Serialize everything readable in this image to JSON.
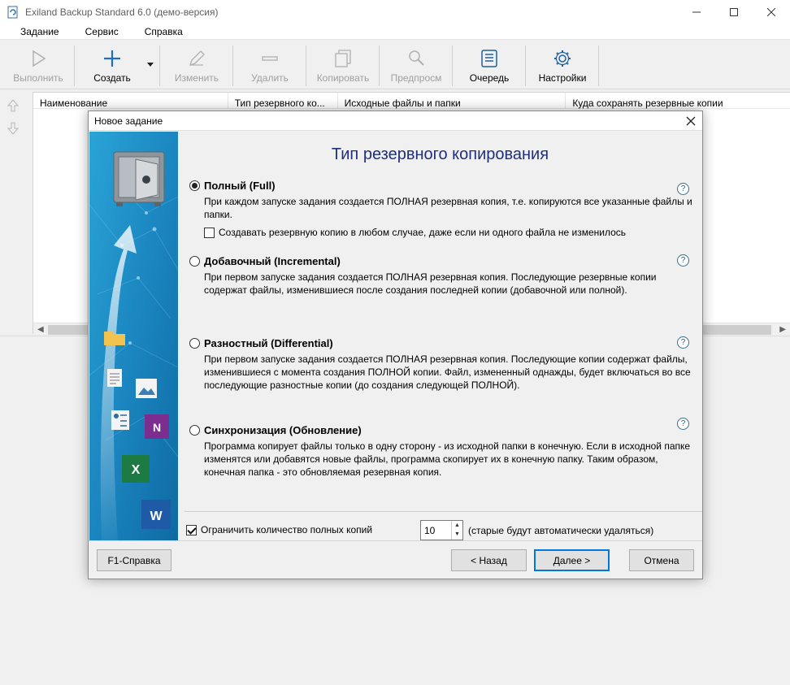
{
  "window": {
    "title": "Exiland Backup Standard 6.0 (демо-версия)",
    "controls": [
      "minimize-icon",
      "maximize-icon",
      "close-icon"
    ]
  },
  "menu": [
    "Задание",
    "Сервис",
    "Справка"
  ],
  "toolbar": {
    "buttons": [
      {
        "label": "Выполнить",
        "icon": "play-icon",
        "enabled": false
      },
      {
        "label": "Создать",
        "icon": "plus-icon",
        "enabled": true
      },
      {
        "label": "Изменить",
        "icon": "pencil-icon",
        "enabled": false
      },
      {
        "label": "Удалить",
        "icon": "minus-icon",
        "enabled": false
      },
      {
        "label": "Копировать",
        "icon": "copy-icon",
        "enabled": false
      },
      {
        "label": "Предпросм",
        "icon": "magnifier-icon",
        "enabled": false
      },
      {
        "label": "Очередь",
        "icon": "queue-list-icon",
        "enabled": true
      },
      {
        "label": "Настройки",
        "icon": "gear-icon",
        "enabled": true
      }
    ]
  },
  "list": {
    "columns": [
      "Наименование",
      "Тип резервного ко...",
      "Исходные файлы и папки",
      "Куда сохранять резервные копии"
    ]
  },
  "dialog": {
    "title": "Новое задание",
    "heading": "Тип резервного копирования",
    "options": [
      {
        "label": "Полный (Full)",
        "checked": true,
        "description": "При каждом запуске задания создается ПОЛНАЯ резервная копия, т.е. копируются все указанные файлы и папки.",
        "sub_checkbox": {
          "label": "Создавать резервную копию в любом случае, даже если ни одного файла не изменилось",
          "checked": false
        }
      },
      {
        "label": "Добавочный (Incremental)",
        "checked": false,
        "description": "При первом запуске задания создается ПОЛНАЯ резервная копия. Последующие резервные копии содержат файлы, изменившиеся после создания последней копии (добавочной или полной)."
      },
      {
        "label": "Разностный (Differential)",
        "checked": false,
        "description": "При первом запуске задания создается ПОЛНАЯ резервная копия. Последующие копии содержат файлы, изменившиеся с момента создания ПОЛНОЙ копии. Файл, измененный однажды, будет включаться во все последующие разностные копии (до создания следующей ПОЛНОЙ)."
      },
      {
        "label": "Синхронизация (Обновление)",
        "checked": false,
        "description": "Программа копирует файлы только в одну сторону - из исходной папки в конечную. Если в исходной папке изменятся или добавятся новые файлы, программа скопирует их в конечную папку. Таким образом, конечная папка - это обновляемая резервная копия."
      }
    ],
    "help_glyph": "?",
    "limit": {
      "label": "Ограничить количество полных копий",
      "checked": true,
      "value": "10",
      "note": "(старые будут автоматически удаляться)"
    },
    "buttons": {
      "help": "F1-Справка",
      "back": "< Назад",
      "next": "Далее >",
      "cancel": "Отмена"
    }
  },
  "colors": {
    "heading": "#1f2f7a",
    "accent": "#0078d7",
    "panel_blue": "#1a8fc4"
  }
}
